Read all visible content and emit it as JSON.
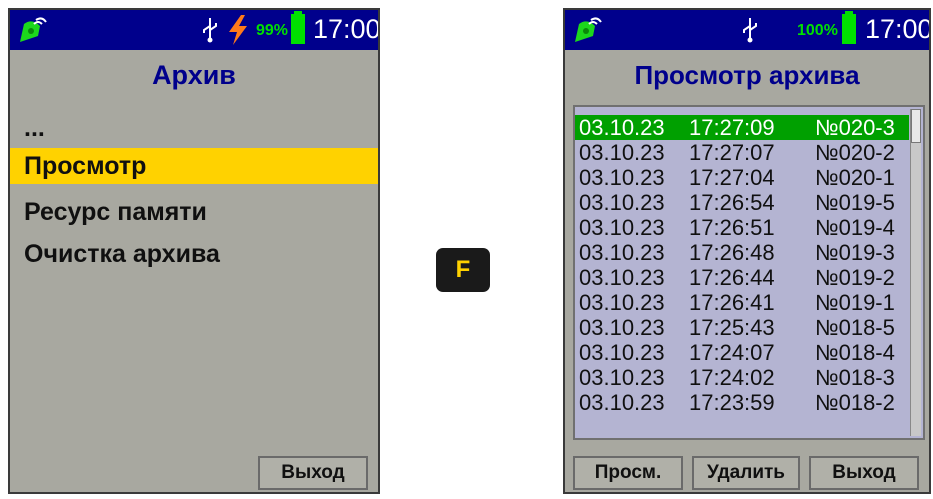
{
  "left_screen": {
    "status": {
      "battery_percent": "99%",
      "time": "17:00",
      "charging": true
    },
    "title": "Архив",
    "menu": [
      {
        "label": "...",
        "selected": false
      },
      {
        "label": "Просмотр",
        "selected": true
      },
      {
        "label": "Ресурс памяти",
        "selected": false
      },
      {
        "label": "Очистка архива",
        "selected": false
      }
    ],
    "exit_label": "Выход"
  },
  "key_label": "F",
  "right_screen": {
    "status": {
      "battery_percent": "100%",
      "time": "17:00",
      "charging": false
    },
    "title": "Просмотр архива",
    "records": [
      {
        "date": "03.10.23",
        "time": "17:27:09",
        "id": "№020-3",
        "selected": true
      },
      {
        "date": "03.10.23",
        "time": "17:27:07",
        "id": "№020-2",
        "selected": false
      },
      {
        "date": "03.10.23",
        "time": "17:27:04",
        "id": "№020-1",
        "selected": false
      },
      {
        "date": "03.10.23",
        "time": "17:26:54",
        "id": "№019-5",
        "selected": false
      },
      {
        "date": "03.10.23",
        "time": "17:26:51",
        "id": "№019-4",
        "selected": false
      },
      {
        "date": "03.10.23",
        "time": "17:26:48",
        "id": "№019-3",
        "selected": false
      },
      {
        "date": "03.10.23",
        "time": "17:26:44",
        "id": "№019-2",
        "selected": false
      },
      {
        "date": "03.10.23",
        "time": "17:26:41",
        "id": "№019-1",
        "selected": false
      },
      {
        "date": "03.10.23",
        "time": "17:25:43",
        "id": "№018-5",
        "selected": false
      },
      {
        "date": "03.10.23",
        "time": "17:24:07",
        "id": "№018-4",
        "selected": false
      },
      {
        "date": "03.10.23",
        "time": "17:24:02",
        "id": "№018-3",
        "selected": false
      },
      {
        "date": "03.10.23",
        "time": "17:23:59",
        "id": "№018-2",
        "selected": false
      }
    ],
    "buttons": {
      "view": "Просм.",
      "delete": "Удалить",
      "exit": "Выход"
    }
  },
  "colors": {
    "status_bar": "#00008c",
    "screen_bg": "#a8a8a0",
    "highlight": "#ffd200",
    "list_bg": "#b4b4d2",
    "selected_row": "#00a000"
  }
}
